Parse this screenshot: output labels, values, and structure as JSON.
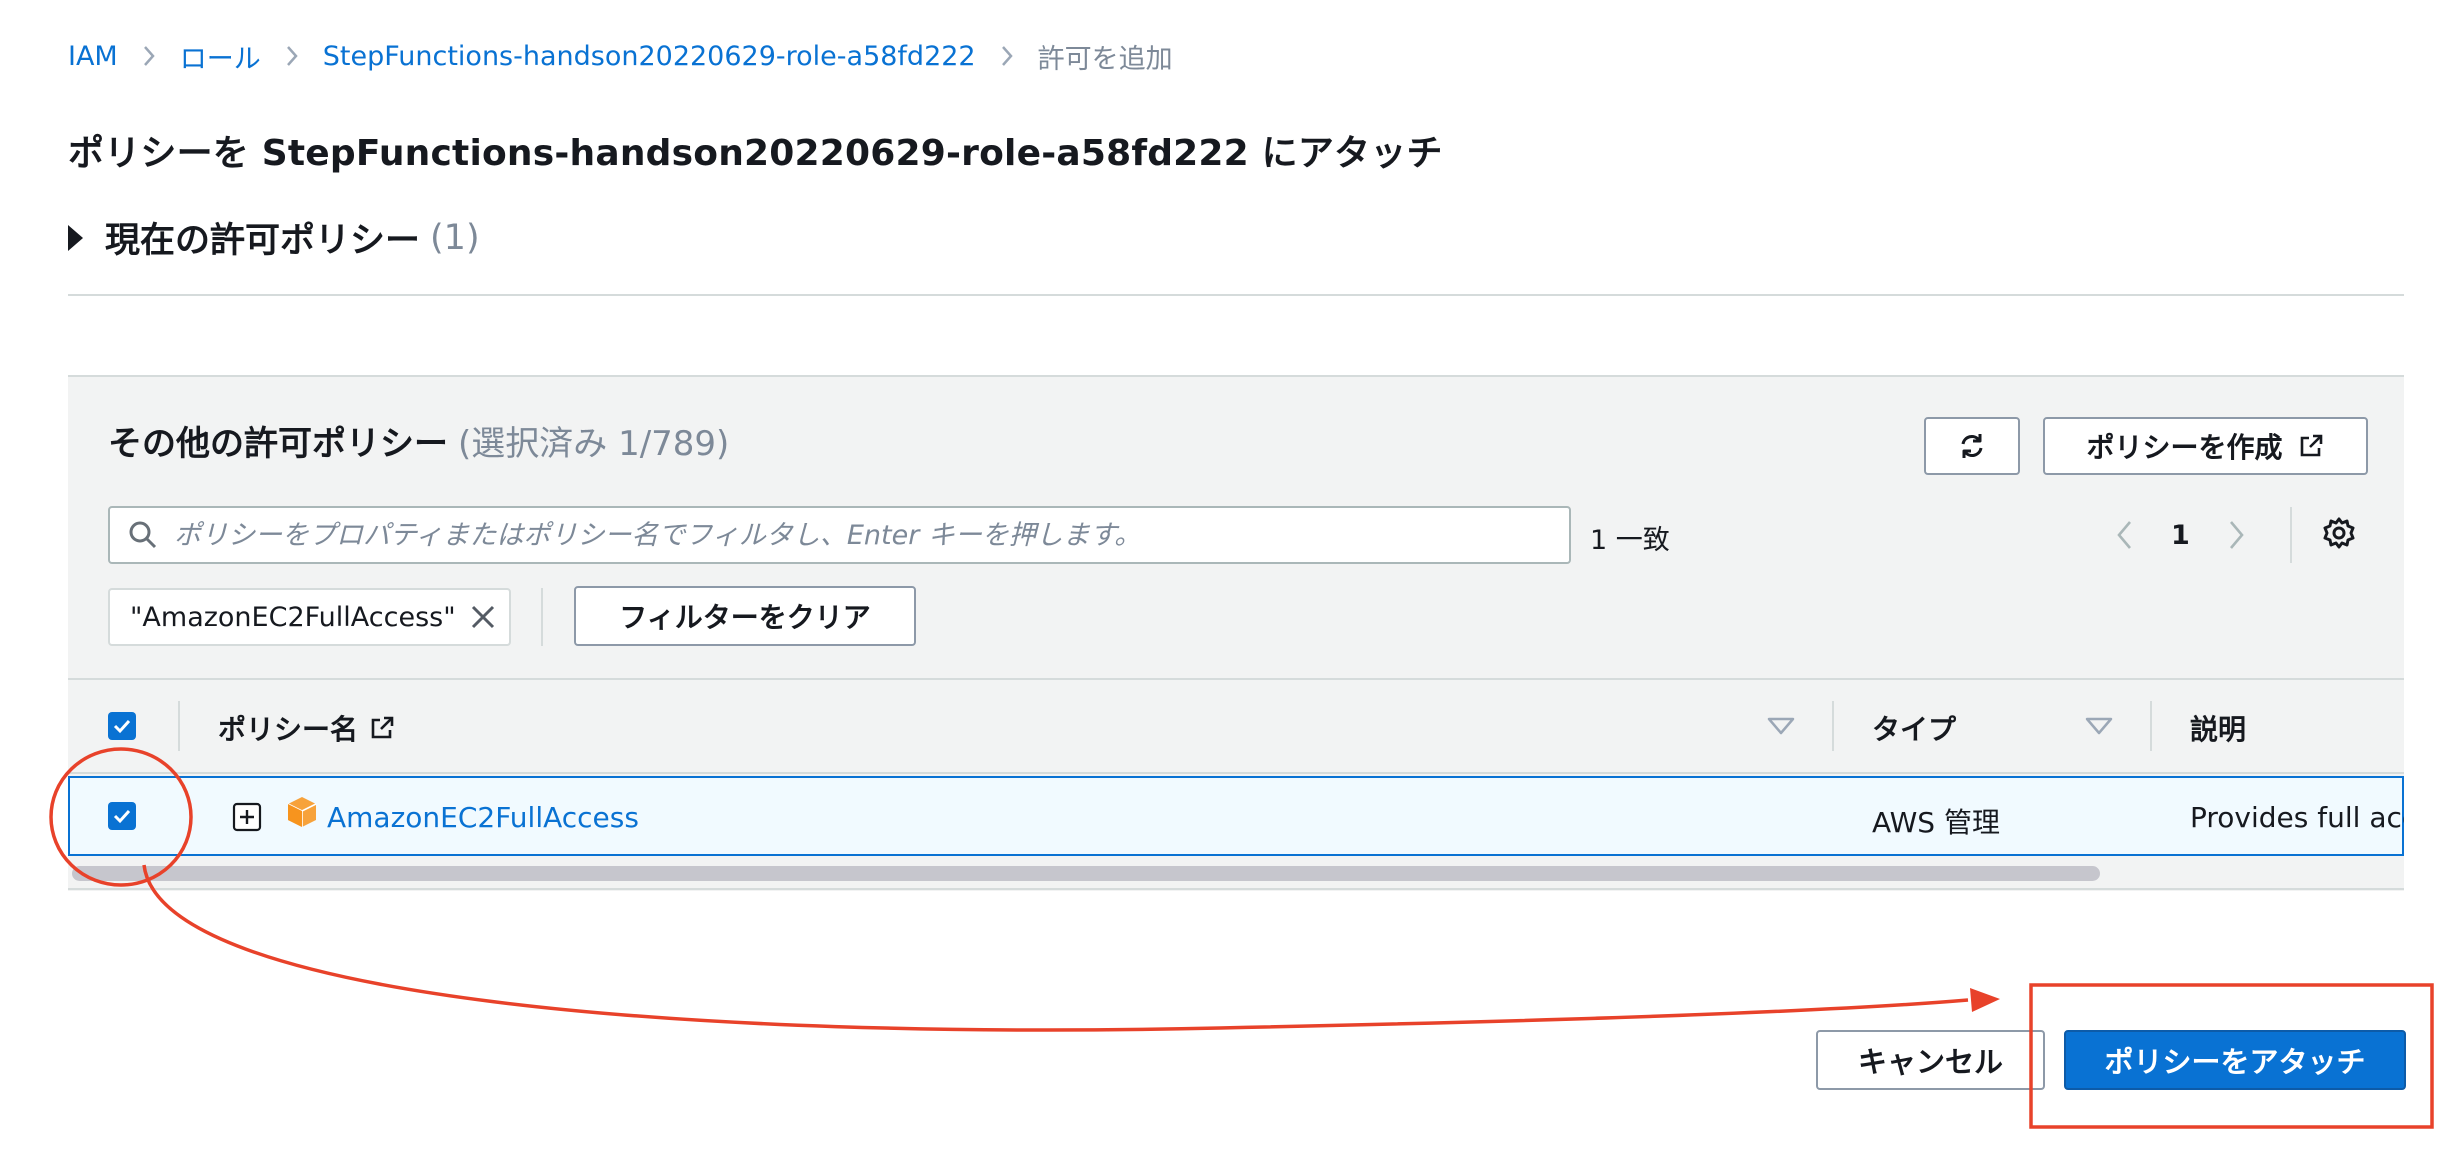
{
  "breadcrumb": {
    "items": [
      "IAM",
      "ロール",
      "StepFunctions-handson20220629-role-a58fd222"
    ],
    "current": "許可を追加"
  },
  "page": {
    "title": "ポリシーを StepFunctions-handson20220629-role-a58fd222 にアタッチ"
  },
  "current_policies": {
    "label": "現在の許可ポリシー",
    "count": "(1)"
  },
  "other_policies": {
    "title": "その他の許可ポリシー",
    "selection": "(選択済み 1/789)",
    "create_button": "ポリシーを作成",
    "search_placeholder": "ポリシーをプロパティまたはポリシー名でフィルタし、Enter キーを押します。",
    "match_count": "1 一致",
    "page_number": "1",
    "filter_token": "\"AmazonEC2FullAccess\"",
    "clear_button": "フィルターをクリア"
  },
  "table": {
    "columns": [
      "ポリシー名",
      "タイプ",
      "説明"
    ],
    "rows": [
      {
        "name": "AmazonEC2FullAccess",
        "type": "AWS 管理",
        "description": "Provides full acce",
        "selected": true
      }
    ]
  },
  "footer": {
    "cancel": "キャンセル",
    "attach": "ポリシーをアタッチ"
  },
  "colors": {
    "link": "#0972d3",
    "primary": "#0972d3",
    "annotation": "#e8422a",
    "panel_bg": "#f2f3f3",
    "aws_orange": "#f7a23b"
  }
}
